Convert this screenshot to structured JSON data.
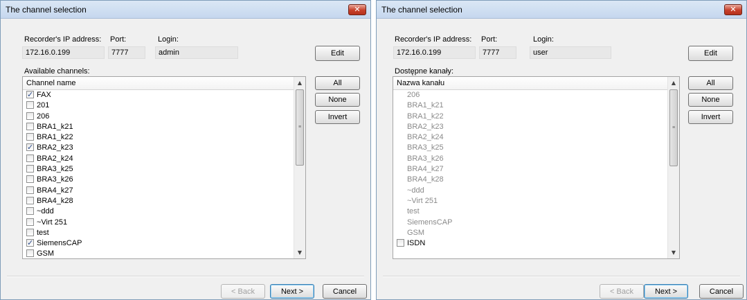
{
  "left_dialog": {
    "title": "The channel selection",
    "close_label": "✕",
    "ip_label": "Recorder's IP address:",
    "ip_value": "172.16.0.199",
    "port_label": "Port:",
    "port_value": "7777",
    "login_label": "Login:",
    "login_value": "admin",
    "edit_label": "Edit",
    "channels_label": "Available channels:",
    "column_header": "Channel name",
    "all_label": "All",
    "none_label": "None",
    "invert_label": "Invert",
    "back_label": "< Back",
    "next_label": "Next >",
    "cancel_label": "Cancel",
    "channels": [
      {
        "name": "FAX",
        "checked": true
      },
      {
        "name": "201",
        "checked": false
      },
      {
        "name": "206",
        "checked": false
      },
      {
        "name": "BRA1_k21",
        "checked": false
      },
      {
        "name": "BRA1_k22",
        "checked": false
      },
      {
        "name": "BRA2_k23",
        "checked": true
      },
      {
        "name": "BRA2_k24",
        "checked": false
      },
      {
        "name": "BRA3_k25",
        "checked": false
      },
      {
        "name": "BRA3_k26",
        "checked": false
      },
      {
        "name": "BRA4_k27",
        "checked": false
      },
      {
        "name": "BRA4_k28",
        "checked": false
      },
      {
        "name": "~ddd",
        "checked": false
      },
      {
        "name": "~Virt 251",
        "checked": false
      },
      {
        "name": "test",
        "checked": false
      },
      {
        "name": "SiemensCAP",
        "checked": true
      },
      {
        "name": "GSM",
        "checked": false
      }
    ]
  },
  "right_dialog": {
    "title": "The channel selection",
    "close_label": "✕",
    "ip_label": "Recorder's IP address:",
    "ip_value": "172.16.0.199",
    "port_label": "Port:",
    "port_value": "7777",
    "login_label": "Login:",
    "login_value": "user",
    "edit_label": "Edit",
    "channels_label": "Dostępne kanały:",
    "column_header": "Nazwa kanału",
    "all_label": "All",
    "none_label": "None",
    "invert_label": "Invert",
    "back_label": "< Back",
    "next_label": "Next >",
    "cancel_label": "Cancel",
    "channels": [
      {
        "name": "206",
        "checkbox": false
      },
      {
        "name": "BRA1_k21",
        "checkbox": false
      },
      {
        "name": "BRA1_k22",
        "checkbox": false
      },
      {
        "name": "BRA2_k23",
        "checkbox": false
      },
      {
        "name": "BRA2_k24",
        "checkbox": false
      },
      {
        "name": "BRA3_k25",
        "checkbox": false
      },
      {
        "name": "BRA3_k26",
        "checkbox": false
      },
      {
        "name": "BRA4_k27",
        "checkbox": false
      },
      {
        "name": "BRA4_k28",
        "checkbox": false
      },
      {
        "name": "~ddd",
        "checkbox": false
      },
      {
        "name": "~Virt 251",
        "checkbox": false
      },
      {
        "name": "test",
        "checkbox": false
      },
      {
        "name": "SiemensCAP",
        "checkbox": false
      },
      {
        "name": "GSM",
        "checkbox": false
      },
      {
        "name": "ISDN",
        "checkbox": true,
        "checked": false
      }
    ]
  }
}
